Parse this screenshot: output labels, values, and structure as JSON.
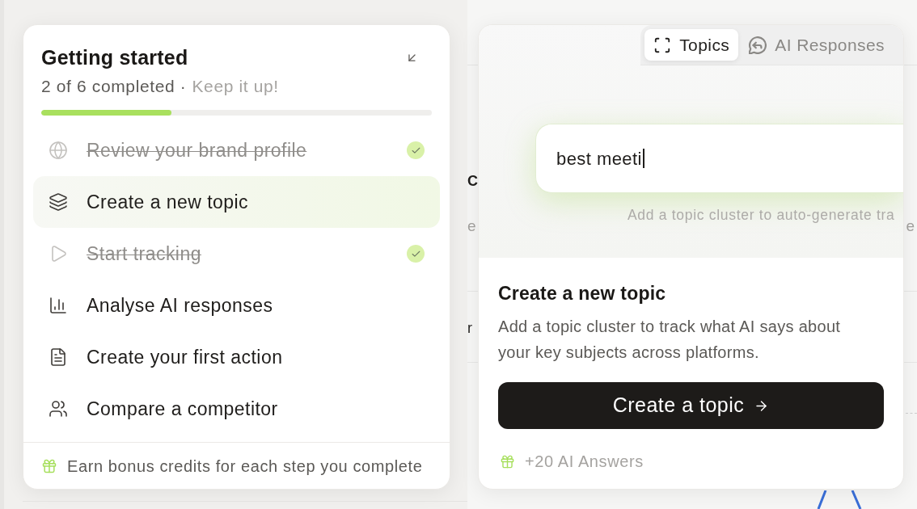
{
  "background_fragments": [
    {
      "text": "C",
      "kind": "heading"
    },
    {
      "text": "e",
      "kind": "subtitle"
    },
    {
      "text": "r",
      "kind": "label"
    },
    {
      "text": "e",
      "kind": "subtitle"
    }
  ],
  "checklist": {
    "title": "Getting started",
    "progress_text": "2 of 6 completed ·",
    "encouragement": "Keep it up!",
    "progress": {
      "level": 0.333
    },
    "steps": [
      {
        "label": "Review your brand profile",
        "completed": true,
        "selected": false
      },
      {
        "label": "Create a new topic",
        "completed": false,
        "selected": true
      },
      {
        "label": "Start tracking",
        "completed": true,
        "selected": false
      },
      {
        "label": "Analyse AI responses",
        "completed": false,
        "selected": false
      },
      {
        "label": "Create your first action",
        "completed": false,
        "selected": false
      },
      {
        "label": "Compare a competitor",
        "completed": false,
        "selected": false
      }
    ],
    "footer": "Earn bonus credits for each step you complete"
  },
  "detail_card": {
    "tabs": [
      {
        "label": "Topics",
        "selected": true
      },
      {
        "label": "AI Responses",
        "selected": false
      }
    ],
    "preview": {
      "input_value": "best meeti",
      "hint": "Add a topic cluster to auto-generate tra"
    },
    "title": "Create a new topic",
    "description": "Add a topic cluster to track what AI says about your key subjects across platforms.",
    "button": "Create a topic",
    "reward": "+20 AI Answers"
  }
}
